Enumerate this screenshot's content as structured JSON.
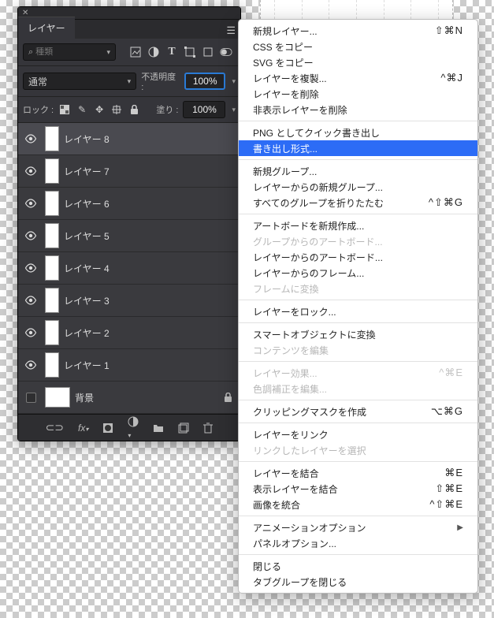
{
  "panel": {
    "tab_label": "レイヤー",
    "filter": {
      "placeholder": "種類"
    },
    "blend": {
      "mode": "通常",
      "opacity_label": "不透明度 :",
      "opacity_value": "100%"
    },
    "lock": {
      "label": "ロック :",
      "fill_label": "塗り :",
      "fill_value": "100%"
    },
    "layers": [
      {
        "name": "レイヤー 8",
        "visible": true,
        "selected": true,
        "locked": false,
        "bg": false
      },
      {
        "name": "レイヤー 7",
        "visible": true,
        "selected": false,
        "locked": false,
        "bg": false
      },
      {
        "name": "レイヤー 6",
        "visible": true,
        "selected": false,
        "locked": false,
        "bg": false
      },
      {
        "name": "レイヤー 5",
        "visible": true,
        "selected": false,
        "locked": false,
        "bg": false
      },
      {
        "name": "レイヤー 4",
        "visible": true,
        "selected": false,
        "locked": false,
        "bg": false
      },
      {
        "name": "レイヤー 3",
        "visible": true,
        "selected": false,
        "locked": false,
        "bg": false
      },
      {
        "name": "レイヤー 2",
        "visible": true,
        "selected": false,
        "locked": false,
        "bg": false
      },
      {
        "name": "レイヤー 1",
        "visible": true,
        "selected": false,
        "locked": false,
        "bg": false
      },
      {
        "name": "背景",
        "visible": false,
        "selected": false,
        "locked": true,
        "bg": true
      }
    ]
  },
  "context_menu": [
    {
      "type": "item",
      "label": "新規レイヤー...",
      "shortcut": "⇧⌘N"
    },
    {
      "type": "item",
      "label": "CSS をコピー"
    },
    {
      "type": "item",
      "label": "SVG をコピー"
    },
    {
      "type": "item",
      "label": "レイヤーを複製...",
      "shortcut": "^⌘J"
    },
    {
      "type": "item",
      "label": "レイヤーを削除"
    },
    {
      "type": "item",
      "label": "非表示レイヤーを削除"
    },
    {
      "type": "sep"
    },
    {
      "type": "item",
      "label": "PNG としてクイック書き出し"
    },
    {
      "type": "item",
      "label": "書き出し形式...",
      "highlighted": true
    },
    {
      "type": "sep"
    },
    {
      "type": "item",
      "label": "新規グループ..."
    },
    {
      "type": "item",
      "label": "レイヤーからの新規グループ..."
    },
    {
      "type": "item",
      "label": "すべてのグループを折りたたむ",
      "shortcut": "^⇧⌘G"
    },
    {
      "type": "sep"
    },
    {
      "type": "item",
      "label": "アートボードを新規作成..."
    },
    {
      "type": "item",
      "label": "グループからのアートボード...",
      "disabled": true
    },
    {
      "type": "item",
      "label": "レイヤーからのアートボード..."
    },
    {
      "type": "item",
      "label": "レイヤーからのフレーム..."
    },
    {
      "type": "item",
      "label": "フレームに変換",
      "disabled": true
    },
    {
      "type": "sep"
    },
    {
      "type": "item",
      "label": "レイヤーをロック..."
    },
    {
      "type": "sep"
    },
    {
      "type": "item",
      "label": "スマートオブジェクトに変換"
    },
    {
      "type": "item",
      "label": "コンテンツを編集",
      "disabled": true
    },
    {
      "type": "sep"
    },
    {
      "type": "item",
      "label": "レイヤー効果...",
      "disabled": true,
      "shortcut": "^⌘E"
    },
    {
      "type": "item",
      "label": "色調補正を編集...",
      "disabled": true
    },
    {
      "type": "sep"
    },
    {
      "type": "item",
      "label": "クリッピングマスクを作成",
      "shortcut": "⌥⌘G"
    },
    {
      "type": "sep"
    },
    {
      "type": "item",
      "label": "レイヤーをリンク"
    },
    {
      "type": "item",
      "label": "リンクしたレイヤーを選択",
      "disabled": true
    },
    {
      "type": "sep"
    },
    {
      "type": "item",
      "label": "レイヤーを結合",
      "shortcut": "⌘E"
    },
    {
      "type": "item",
      "label": "表示レイヤーを結合",
      "shortcut": "⇧⌘E"
    },
    {
      "type": "item",
      "label": "画像を統合",
      "shortcut": "^⇧⌘E"
    },
    {
      "type": "sep"
    },
    {
      "type": "item",
      "label": "アニメーションオプション",
      "submenu": true
    },
    {
      "type": "item",
      "label": "パネルオプション..."
    },
    {
      "type": "sep"
    },
    {
      "type": "item",
      "label": "閉じる"
    },
    {
      "type": "item",
      "label": "タブグループを閉じる"
    }
  ]
}
